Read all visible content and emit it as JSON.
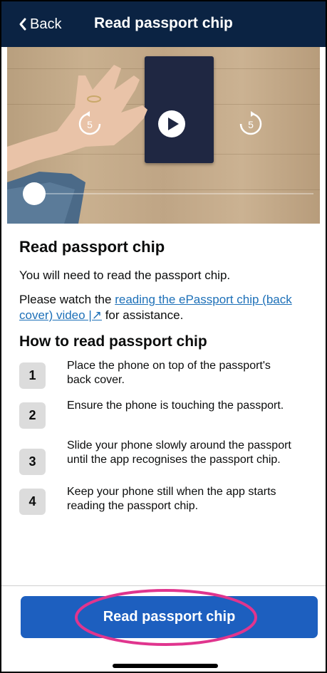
{
  "header": {
    "back_label": "Back",
    "title": "Read passport chip"
  },
  "video": {
    "rewind_seconds": "5",
    "forward_seconds": "5"
  },
  "main": {
    "heading": "Read passport chip",
    "intro": "You will need to read the passport chip.",
    "watch_prefix": "Please watch the ",
    "watch_link": "reading the ePassport chip (back cover) video |↗",
    "watch_suffix": " for assistance.",
    "how_heading": "How to read passport chip",
    "steps": [
      {
        "number": "1",
        "text": "Place the phone on top of the passport's back cover."
      },
      {
        "number": "2",
        "text": "Ensure the phone is touching the passport."
      },
      {
        "number": "3",
        "text": "Slide your phone slowly around the passport until the app recognises the passport chip."
      },
      {
        "number": "4",
        "text": "Keep your phone still when the app starts reading the passport chip."
      }
    ]
  },
  "footer": {
    "cta_label": "Read passport chip"
  },
  "colors": {
    "header_bg": "#0b2343",
    "link": "#1d70b8",
    "button": "#1d5fbf",
    "highlight": "#e0358e"
  }
}
